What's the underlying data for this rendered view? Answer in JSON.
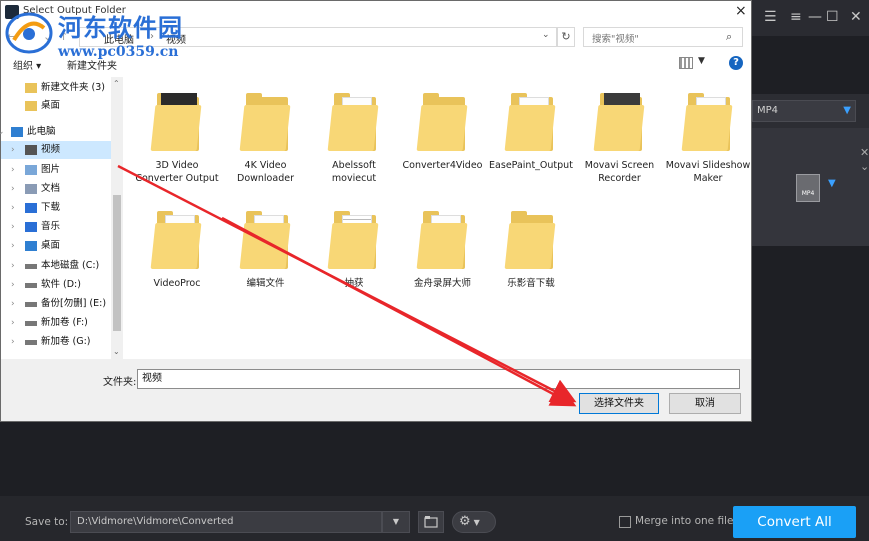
{
  "dialog": {
    "title": "Select Output Folder",
    "close": "×",
    "breadcrumb": [
      "此电脑",
      "视频"
    ],
    "search_placeholder": "搜索\"视频\"",
    "toolbar": {
      "organize": "组织 ▾",
      "new_folder": "新建文件夹"
    },
    "nav": [
      {
        "label": "新建文件夹 (3)",
        "icon": "folder-icon"
      },
      {
        "label": "桌面",
        "icon": "folder-icon"
      },
      {
        "label": "此电脑",
        "icon": "computer-icon"
      },
      {
        "label": "视频",
        "icon": "video-icon",
        "selected": true
      },
      {
        "label": "图片",
        "icon": "picture-icon"
      },
      {
        "label": "文档",
        "icon": "document-icon"
      },
      {
        "label": "下载",
        "icon": "download-icon"
      },
      {
        "label": "音乐",
        "icon": "music-icon"
      },
      {
        "label": "桌面",
        "icon": "desktop-icon"
      },
      {
        "label": "本地磁盘 (C:)",
        "icon": "drive-icon"
      },
      {
        "label": "软件 (D:)",
        "icon": "drive-icon"
      },
      {
        "label": "备份[勿删] (E:)",
        "icon": "drive-icon"
      },
      {
        "label": "新加卷 (F:)",
        "icon": "drive-icon"
      },
      {
        "label": "新加卷 (G:)",
        "icon": "drive-icon"
      }
    ],
    "files": [
      {
        "label": "3D Video Converter Output",
        "kind": "thumb-dark"
      },
      {
        "label": "4K Video Downloader",
        "kind": "plain"
      },
      {
        "label": "Abelssoft moviecut",
        "kind": "paper"
      },
      {
        "label": "Converter4Video",
        "kind": "plain"
      },
      {
        "label": "EasePaint_Output",
        "kind": "paper-blue"
      },
      {
        "label": "Movavi Screen Recorder",
        "kind": "thumb-photo"
      },
      {
        "label": "Movavi Slideshow Maker",
        "kind": "paper"
      },
      {
        "label": "VideoProc",
        "kind": "paper"
      },
      {
        "label": "编辑文件",
        "kind": "paper"
      },
      {
        "label": "抽获",
        "kind": "paper-lines"
      },
      {
        "label": "金舟录屏大师",
        "kind": "paper"
      },
      {
        "label": "乐影音下载",
        "kind": "plain"
      }
    ],
    "filename_label": "文件夹:",
    "filename_value": "视频",
    "select_button": "选择文件夹",
    "cancel_button": "取消"
  },
  "app": {
    "format": "MP4",
    "thumb_label": "MP4",
    "save_to_label": "Save to:",
    "save_path": "D:\\Vidmore\\Vidmore\\Converted",
    "merge_label": "Merge into one file",
    "convert_button": "Convert All"
  },
  "watermark": {
    "title": "河东软件园",
    "url": "www.pc0359.cn"
  },
  "colors": {
    "accent": "#1aa0f6",
    "selection": "#cde8ff",
    "folder": "#f8d776",
    "arrow": "#e8262a"
  }
}
